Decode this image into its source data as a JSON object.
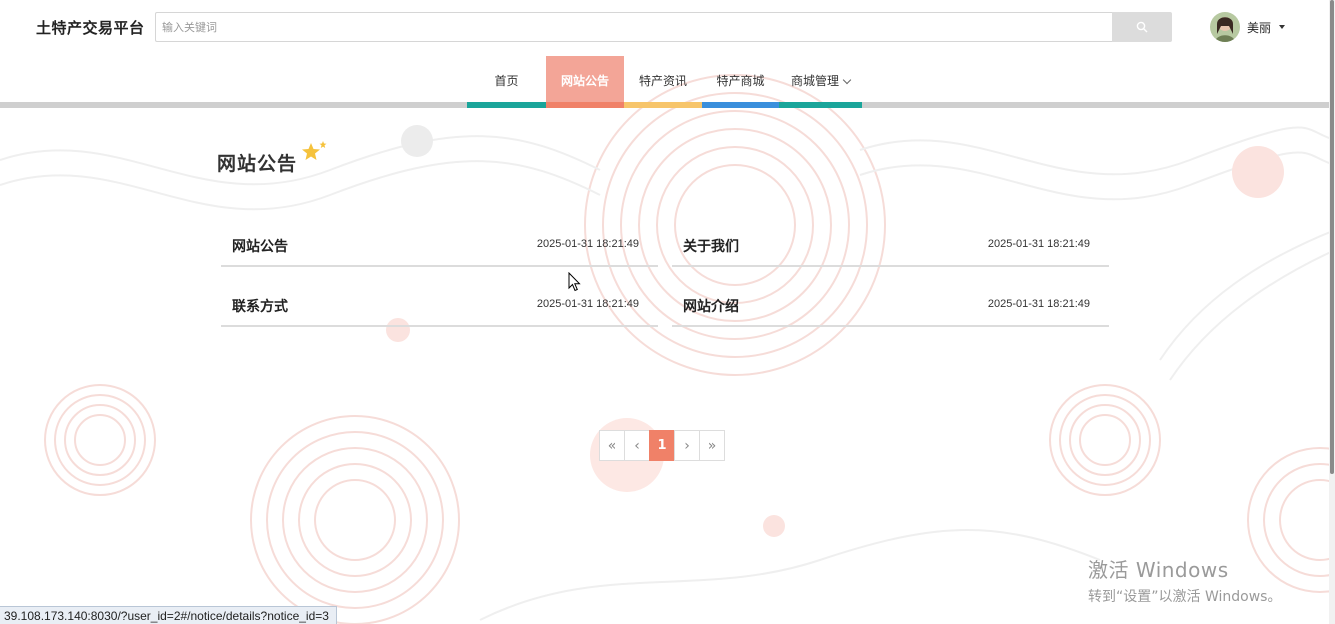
{
  "header": {
    "brand": "土特产交易平台",
    "search_placeholder": "输入关键词",
    "user_name": "美丽"
  },
  "nav": {
    "items": [
      {
        "label": "首页",
        "bar_color": "#1aa59a"
      },
      {
        "label": "网站公告",
        "bar_color": "#f08168",
        "active": true
      },
      {
        "label": "特产资讯",
        "bar_color": "#f7c56b"
      },
      {
        "label": "特产商城",
        "bar_color": "#3a8fdc"
      },
      {
        "label": "商城管理",
        "bar_color": "#1aa59a"
      }
    ]
  },
  "page": {
    "title": "网站公告"
  },
  "notices": [
    {
      "title": "网站公告",
      "date": "2025-01-31 18:21:49"
    },
    {
      "title": "关于我们",
      "date": "2025-01-31 18:21:49"
    },
    {
      "title": "联系方式",
      "date": "2025-01-31 18:21:49"
    },
    {
      "title": "网站介绍",
      "date": "2025-01-31 18:21:49"
    }
  ],
  "pagination": {
    "first": "«",
    "prev": "‹",
    "current": "1",
    "next": "›",
    "last": "»"
  },
  "watermark": {
    "line1": "激活 Windows",
    "line2": "转到“设置”以激活 Windows。"
  },
  "status_url": "39.108.173.140:8030/?user_id=2#/notice/details?notice_id=3",
  "colors": {
    "accent": "#f08168",
    "active_tab": "#f3a597",
    "teal": "#1aa59a",
    "yellow": "#f7c56b",
    "blue": "#3a8fdc"
  }
}
